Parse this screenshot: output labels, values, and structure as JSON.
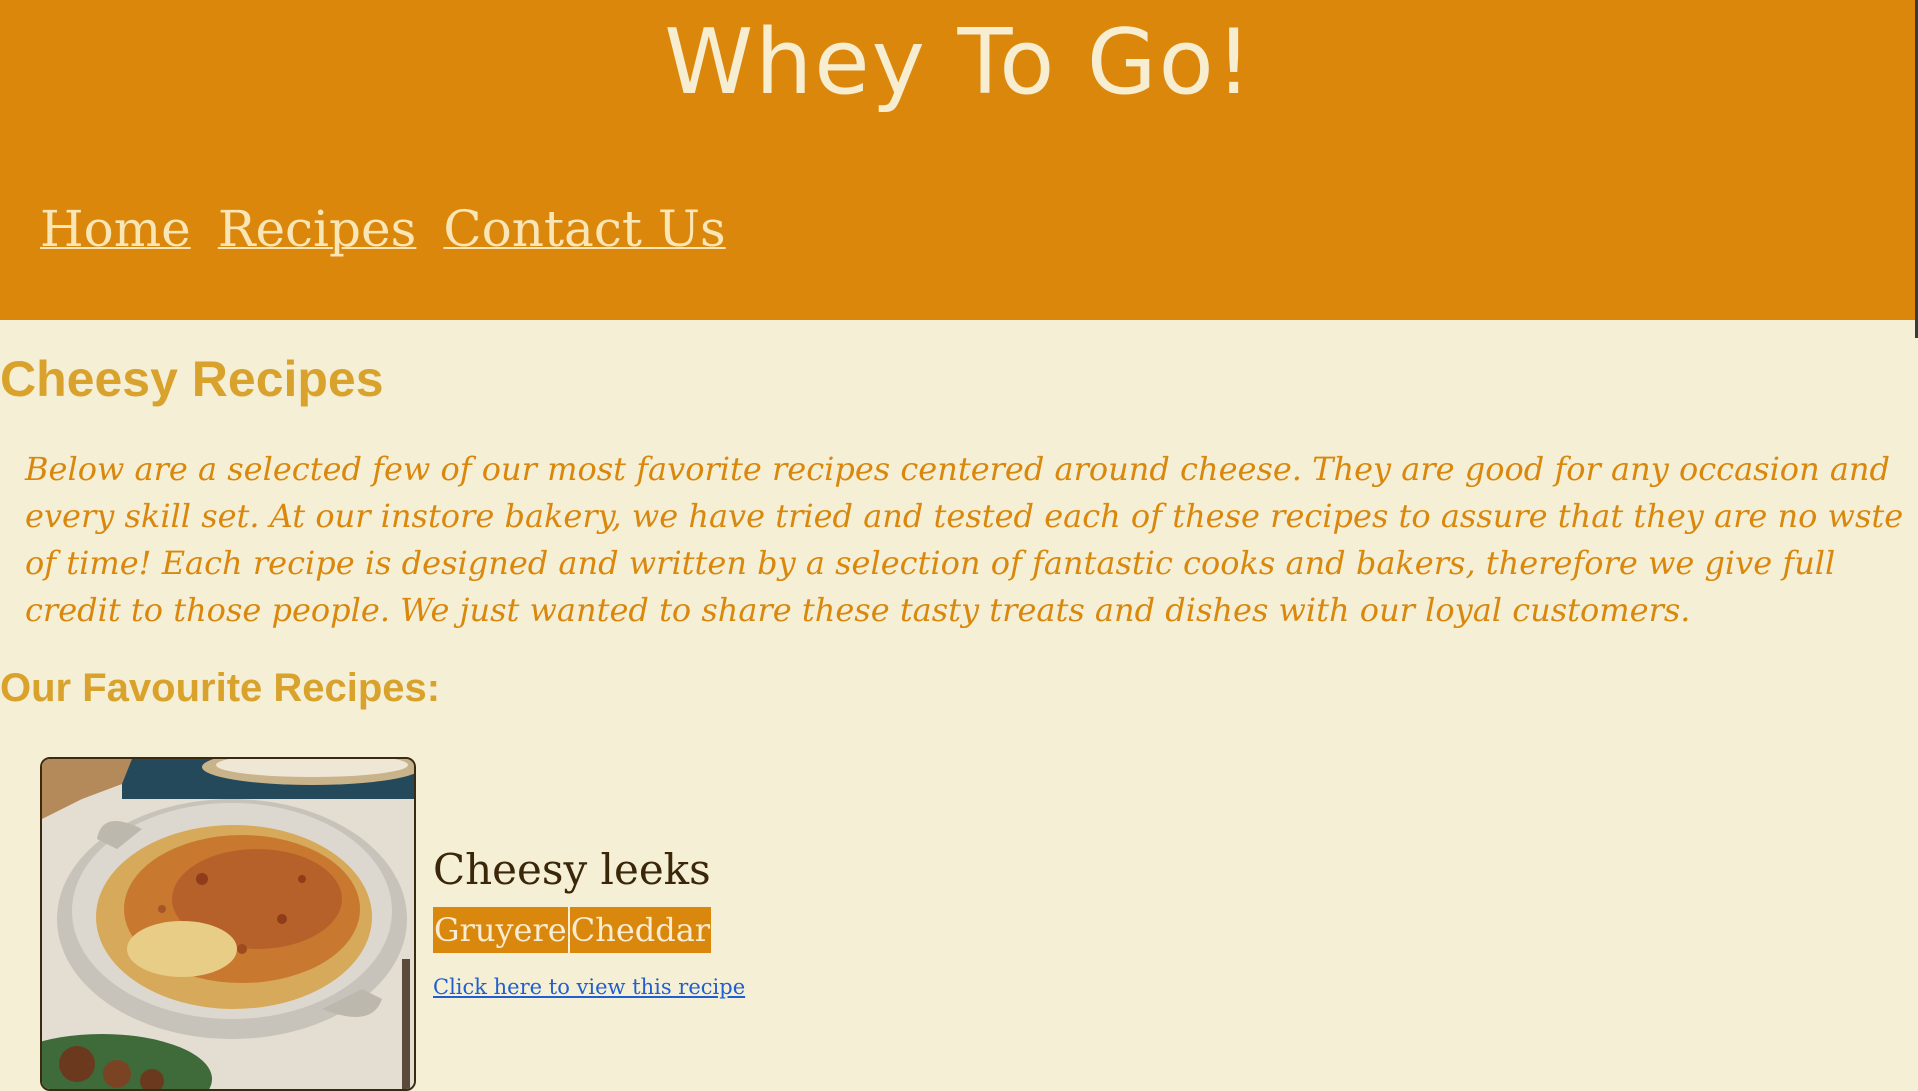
{
  "site": {
    "title": "Whey To Go!",
    "brand_color": "#db870c",
    "background_color": "#f5efd5"
  },
  "nav": {
    "items": [
      {
        "label": "Home"
      },
      {
        "label": "Recipes"
      },
      {
        "label": "Contact Us"
      }
    ]
  },
  "main": {
    "heading": "Cheesy Recipes",
    "intro": "Below are a selected few of our most favorite recipes centered around cheese. They are good for any occasion and every skill set. At our instore bakery, we have tried and tested each of these recipes to assure that they are no wste of time! Each recipe is designed and written by a selection of fantastic cooks and bakers, therefore we give full credit to those people. We just wanted to share these tasty treats and dishes with our loyal customers.",
    "subheading": "Our Favourite Recipes:"
  },
  "recipes": [
    {
      "title": "Cheesy leeks",
      "tags": [
        "Gruyere",
        "Cheddar"
      ],
      "link_text": "Click here to view this recipe",
      "image_icon": "photo-of-baked-leek-gratin-icon"
    }
  ]
}
